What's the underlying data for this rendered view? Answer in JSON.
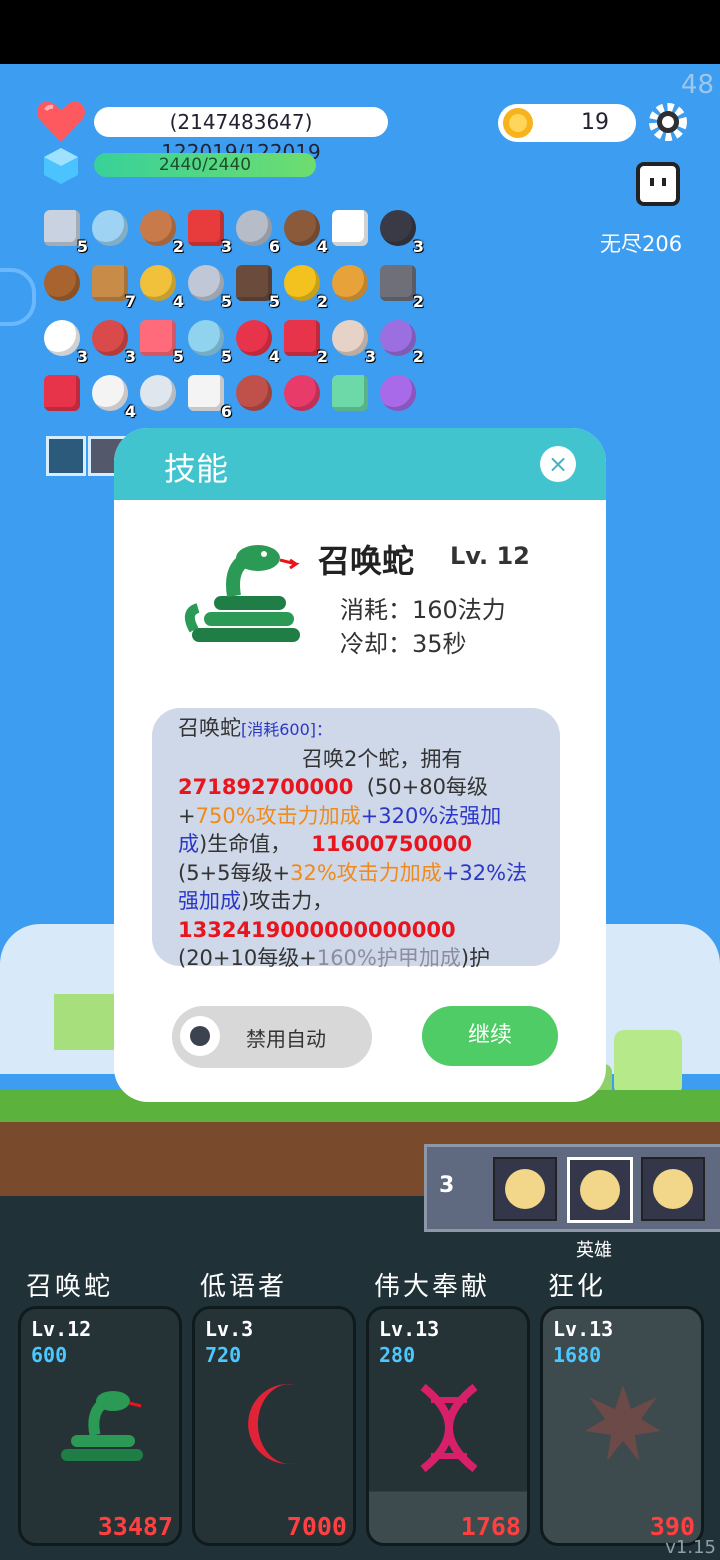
{
  "hud": {
    "fps": "48",
    "hp_text": "(2147483647) 122019/122019",
    "mp_text": "2440/2440",
    "coins": "19",
    "endless": "无尽206"
  },
  "items": [
    {
      "name": "sword-icon",
      "count": "5"
    },
    {
      "name": "magnifier-icon",
      "count": ""
    },
    {
      "name": "shield-icon",
      "count": "2"
    },
    {
      "name": "apple-icon",
      "count": "3"
    },
    {
      "name": "mace-icon",
      "count": "6"
    },
    {
      "name": "coconut-icon",
      "count": "4"
    },
    {
      "name": "arrow-icon",
      "count": ""
    },
    {
      "name": "cauldron-icon",
      "count": "3"
    },
    {
      "name": "chest-icon",
      "count": ""
    },
    {
      "name": "bow-icon",
      "count": "7"
    },
    {
      "name": "ring-icon",
      "count": "4"
    },
    {
      "name": "axe-icon",
      "count": "5"
    },
    {
      "name": "gate-icon",
      "count": "5"
    },
    {
      "name": "sunflower-icon",
      "count": "2"
    },
    {
      "name": "book-icon",
      "count": ""
    },
    {
      "name": "bullets-icon",
      "count": "2"
    },
    {
      "name": "mail-icon",
      "count": "3"
    },
    {
      "name": "crest-icon",
      "count": "3"
    },
    {
      "name": "pill-icon",
      "count": "5"
    },
    {
      "name": "potion-icon",
      "count": "5"
    },
    {
      "name": "strawberry-icon",
      "count": "4"
    },
    {
      "name": "hearts-icon",
      "count": "2"
    },
    {
      "name": "meat-icon",
      "count": "3"
    },
    {
      "name": "gift-box-icon",
      "count": "2"
    },
    {
      "name": "watermelon-icon",
      "count": ""
    },
    {
      "name": "ghost-icon",
      "count": "4"
    },
    {
      "name": "bulb-icon",
      "count": ""
    },
    {
      "name": "dice-icon",
      "count": "6"
    },
    {
      "name": "hook-icon",
      "count": ""
    },
    {
      "name": "jam-icon",
      "count": ""
    },
    {
      "name": "spirit-icon",
      "count": ""
    },
    {
      "name": "crystal-ball-icon",
      "count": ""
    }
  ],
  "dialog": {
    "title": "技能",
    "close": "×",
    "skill_name": "召唤蛇",
    "skill_level": "Lv. 12",
    "cost": "消耗：160法力",
    "cooldown": "冷却：35秒",
    "desc": {
      "l1_name": "召唤蛇",
      "l1_tag": "[消耗600]：",
      "l2": "召唤2个蛇，拥有",
      "hp_val": "271892700000",
      "l3_rest": "(50+80每级",
      "l4_a": "+",
      "l4_b": "750%攻击力加成",
      "l4_c": "+320%法强加",
      "l5_a": "成",
      "l5_b": ")生命值，",
      "atk_val": "11600750000",
      "l6_a": "(5+5每级+",
      "l6_b": "32%攻击力加成",
      "l6_c": "+32%法",
      "l7_a": "强加成",
      "l7_b": ")攻击力，",
      "armor_val": "1332419000000000000",
      "l9_a": "(20+10每级+",
      "l9_b": "160%护甲加成",
      "l9_c": ")护"
    },
    "auto_label": "禁用自动",
    "continue_label": "继续"
  },
  "hero_panel": {
    "count": "3",
    "label": "英雄"
  },
  "skills": [
    {
      "name": "召唤蛇",
      "lv": "Lv.12",
      "mana": "600",
      "cd": "33487",
      "icon": "snake-icon"
    },
    {
      "name": "低语者",
      "lv": "Lv.3",
      "mana": "720",
      "cd": "7000",
      "icon": "crescent-moon-icon"
    },
    {
      "name": "伟大奉献",
      "lv": "Lv.13",
      "mana": "280",
      "cd": "1768",
      "icon": "dna-icon"
    },
    {
      "name": "狂化",
      "lv": "Lv.13",
      "mana": "1680",
      "cd": "390",
      "icon": "burst-icon"
    }
  ],
  "version": "v1.15",
  "colors": {
    "sky": "#3d9df0",
    "dialog_header": "#42c4cf",
    "continue": "#4fcc66",
    "damage_red": "#e8141e"
  }
}
